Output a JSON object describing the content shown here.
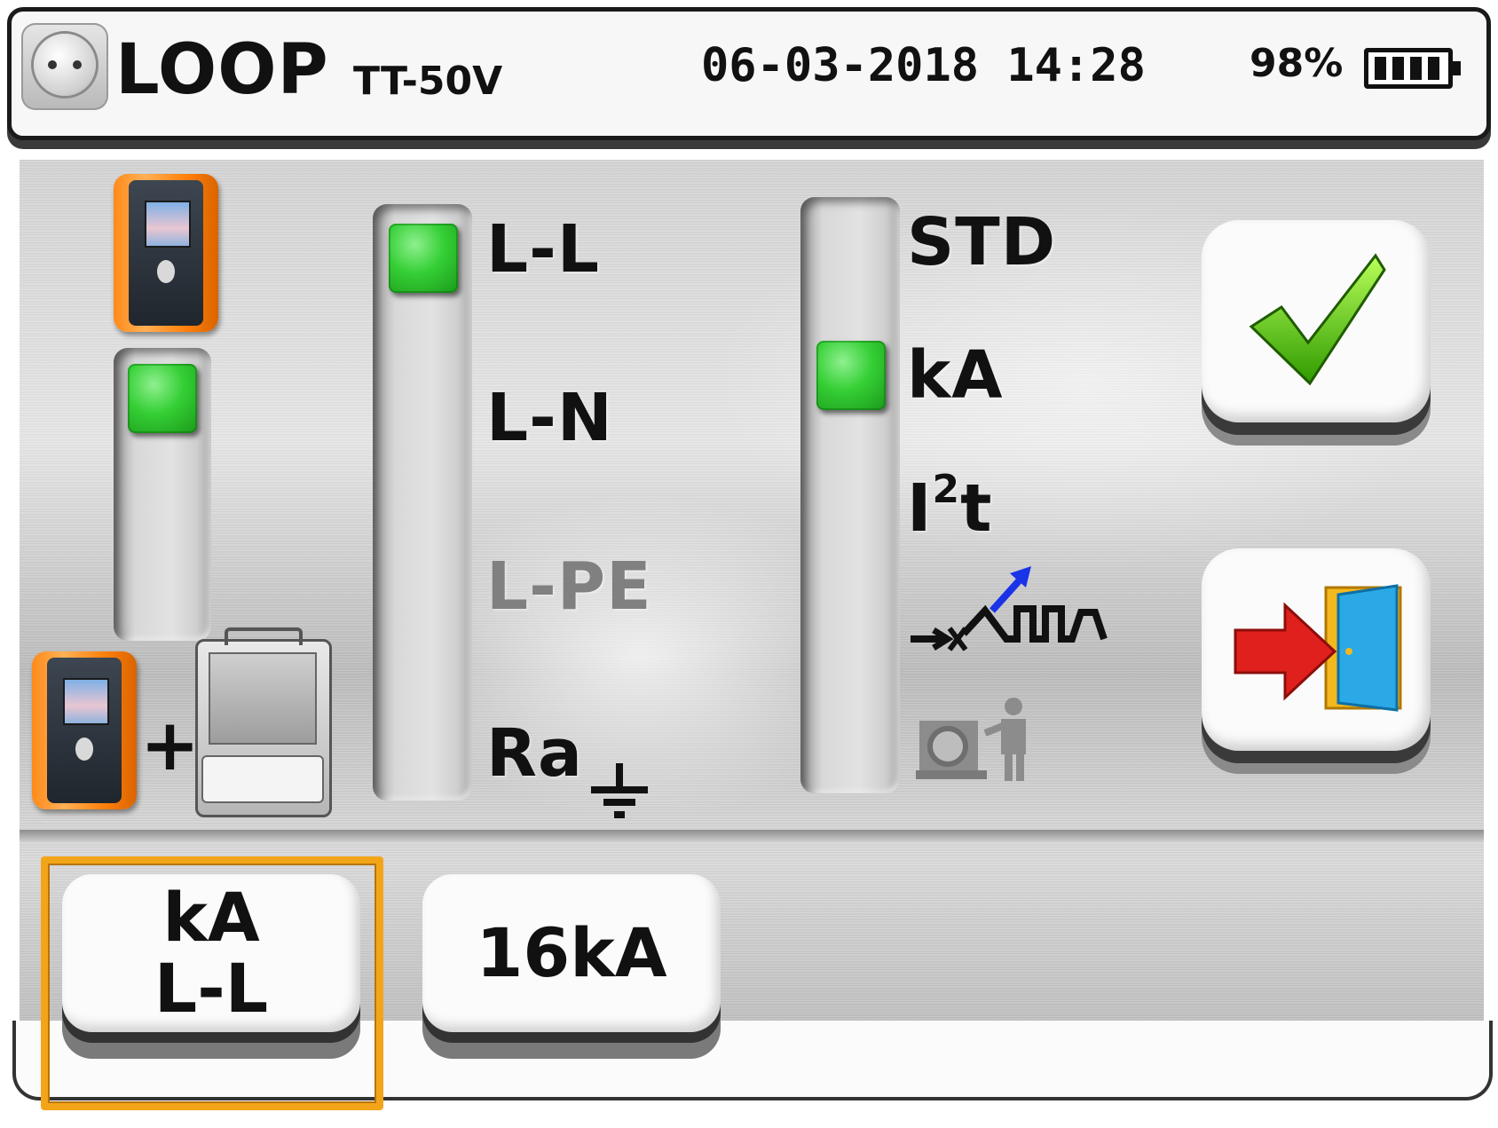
{
  "header": {
    "title": "LOOP",
    "subtitle": "TT-50V",
    "datetime": "06-03-2018 14:28",
    "battery_percent": "98%",
    "battery_level": 0.98
  },
  "mode_selector": {
    "options": [
      "single-instrument-icon",
      "instrument-plus-adapter-icon"
    ],
    "selected_index": 0
  },
  "loop_type": {
    "options": [
      {
        "label": "L-L",
        "enabled": true
      },
      {
        "label": "L-N",
        "enabled": true
      },
      {
        "label": "L-PE",
        "enabled": false
      },
      {
        "label": "Ra",
        "enabled": true,
        "icon": "ground-icon"
      }
    ],
    "selected": "L-L"
  },
  "measurement_type": {
    "options": [
      {
        "label": "STD",
        "enabled": true
      },
      {
        "label": "kA",
        "enabled": true
      },
      {
        "label": "I",
        "superscript": "2",
        "suffix": "t",
        "enabled": true
      },
      {
        "icon": "waveform-icon",
        "enabled": true
      },
      {
        "icon": "motor-person-icon",
        "enabled": false
      }
    ],
    "selected": "kA"
  },
  "actions": {
    "confirm_icon": "checkmark-icon",
    "exit_icon": "exit-door-icon"
  },
  "bottom_buttons": [
    {
      "line1": "kA",
      "line2": "L-L",
      "highlighted": true
    },
    {
      "line1": "16kA",
      "highlighted": false
    }
  ],
  "colors": {
    "knob": "#35cf35",
    "highlight": "#f3a51a",
    "check": "#55d600",
    "exit_arrow": "#e0201c"
  }
}
